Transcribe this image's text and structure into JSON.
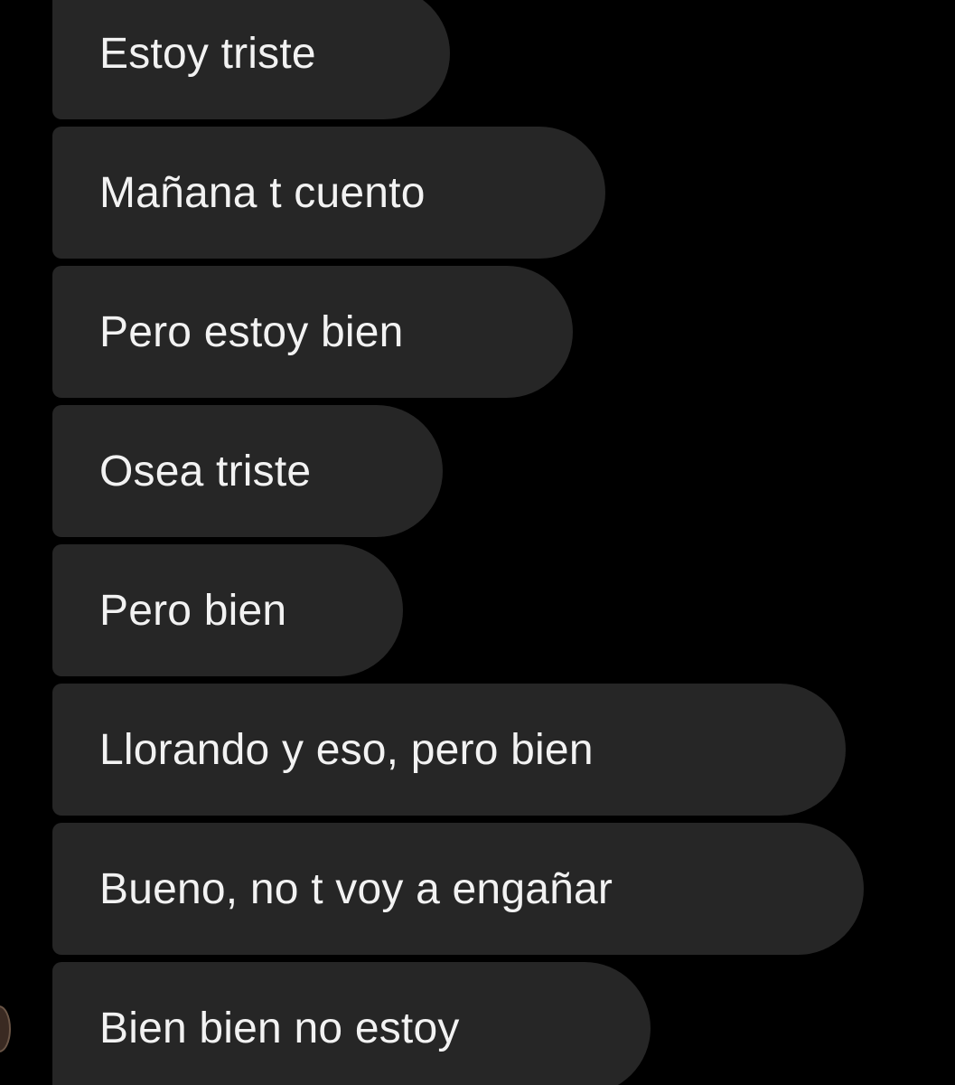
{
  "chat": {
    "messages": [
      {
        "text": "Estoy triste"
      },
      {
        "text": "Mañana t cuento"
      },
      {
        "text": "Pero estoy bien"
      },
      {
        "text": "Osea triste"
      },
      {
        "text": "Pero bien"
      },
      {
        "text": "Llorando y eso, pero bien"
      },
      {
        "text": "Bueno, no t voy a engañar"
      },
      {
        "text": "Bien bien no estoy"
      }
    ]
  },
  "colors": {
    "background": "#000000",
    "bubble": "#262626",
    "text": "#f2f2f2"
  }
}
